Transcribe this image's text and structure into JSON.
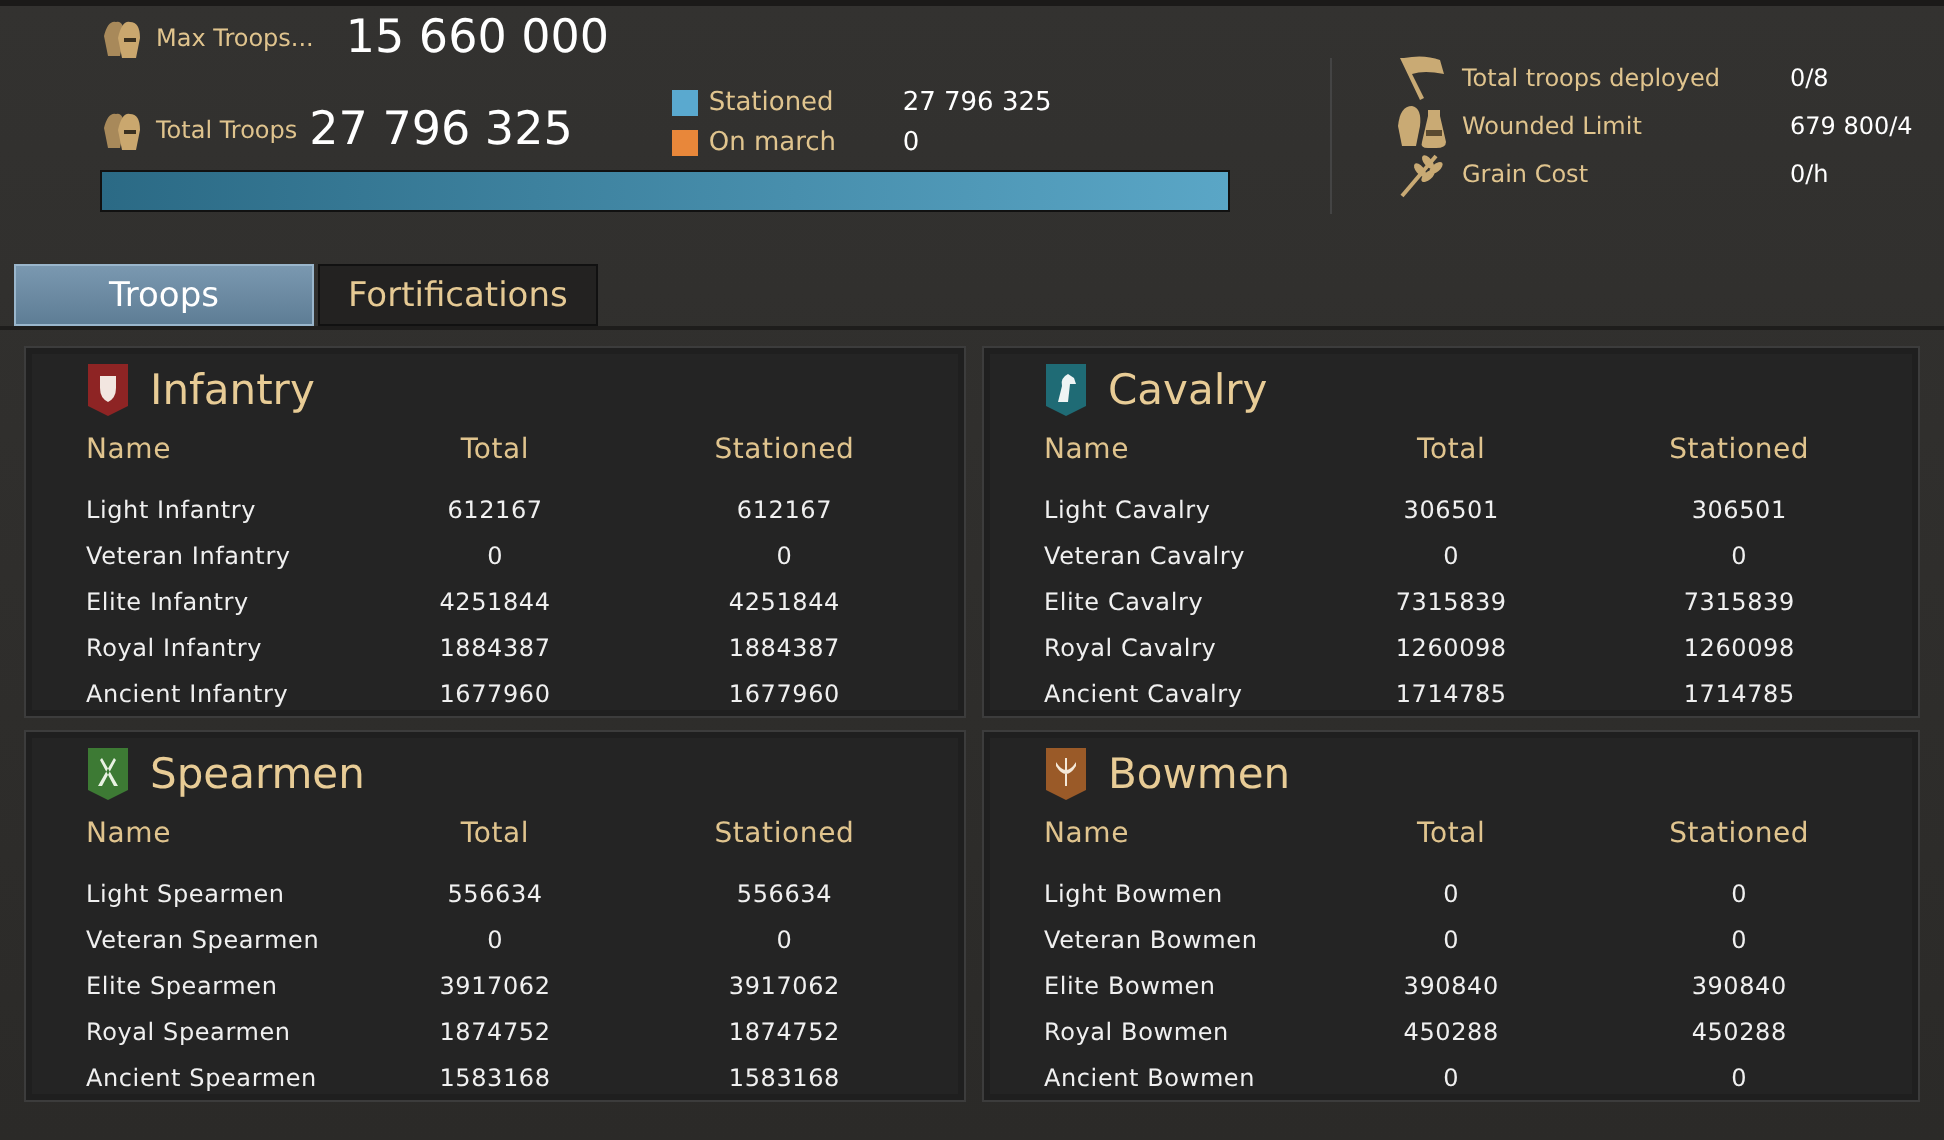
{
  "summary": {
    "max_troops": {
      "label": "Max Troops...",
      "value": "15 660 000"
    },
    "total_troops": {
      "label": "Total Troops",
      "value": "27 796 325"
    },
    "legend": [
      {
        "label": "Stationed",
        "value": "27 796 325",
        "color": "#5aa9cf"
      },
      {
        "label": "On march",
        "value": "0",
        "color": "#e8873a"
      }
    ],
    "progress": {
      "level": 1
    }
  },
  "stats": [
    {
      "kind": "flag",
      "label": "Total troops deployed",
      "value": "0/8"
    },
    {
      "kind": "potion",
      "label": "Wounded Limit",
      "value": "679 800/4"
    },
    {
      "kind": "grain",
      "label": "Grain Cost",
      "value": "0/h"
    }
  ],
  "tabs": [
    {
      "label": "Troops",
      "selected": true
    },
    {
      "label": "Fortifications",
      "selected": false
    }
  ],
  "panels": [
    {
      "title": "Infantry",
      "kind": "shield",
      "color": "#8e2424",
      "columns": [
        "Name",
        "Total",
        "Stationed"
      ],
      "rows": [
        [
          "Light Infantry",
          "612167",
          "612167"
        ],
        [
          "Veteran Infantry",
          "0",
          "0"
        ],
        [
          "Elite Infantry",
          "4251844",
          "4251844"
        ],
        [
          "Royal Infantry",
          "1884387",
          "1884387"
        ],
        [
          "Ancient Infantry",
          "1677960",
          "1677960"
        ]
      ]
    },
    {
      "title": "Cavalry",
      "kind": "horse",
      "color": "#1f6b75",
      "columns": [
        "Name",
        "Total",
        "Stationed"
      ],
      "rows": [
        [
          "Light Cavalry",
          "306501",
          "306501"
        ],
        [
          "Veteran Cavalry",
          "0",
          "0"
        ],
        [
          "Elite Cavalry",
          "7315839",
          "7315839"
        ],
        [
          "Royal Cavalry",
          "1260098",
          "1260098"
        ],
        [
          "Ancient Cavalry",
          "1714785",
          "1714785"
        ]
      ]
    },
    {
      "title": "Spearmen",
      "kind": "spears",
      "color": "#3d7a34",
      "columns": [
        "Name",
        "Total",
        "Stationed"
      ],
      "rows": [
        [
          "Light Spearmen",
          "556634",
          "556634"
        ],
        [
          "Veteran Spearmen",
          "0",
          "0"
        ],
        [
          "Elite Spearmen",
          "3917062",
          "3917062"
        ],
        [
          "Royal Spearmen",
          "1874752",
          "1874752"
        ],
        [
          "Ancient Spearmen",
          "1583168",
          "1583168"
        ]
      ]
    },
    {
      "title": "Bowmen",
      "kind": "bow",
      "color": "#9a5a28",
      "columns": [
        "Name",
        "Total",
        "Stationed"
      ],
      "rows": [
        [
          "Light Bowmen",
          "0",
          "0"
        ],
        [
          "Veteran Bowmen",
          "0",
          "0"
        ],
        [
          "Elite Bowmen",
          "390840",
          "390840"
        ],
        [
          "Royal Bowmen",
          "450288",
          "450288"
        ],
        [
          "Ancient Bowmen",
          "0",
          "0"
        ]
      ]
    }
  ]
}
